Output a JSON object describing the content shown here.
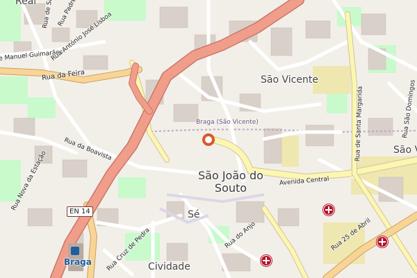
{
  "map": {
    "colors": {
      "background": "#f2efe9",
      "building": "#d9d0c9",
      "primary_road": "#f09e8a",
      "secondary_road": "#f9d497",
      "tertiary_road": "#fcf6b1",
      "minor_road": "#ffffff",
      "park": "#c8facc",
      "railway": "#b9a9c4",
      "marker": "#d65a2c",
      "hospital": "#b3152b"
    },
    "places": {
      "real": "Real",
      "sao_vicente": "São Vicente",
      "sao_joao_line1": "São João do",
      "sao_joao_line2": "Souto",
      "se": "Sé",
      "cividade": "Cividade",
      "sao_v_partial": "São V"
    },
    "streets": {
      "rua_da_feira": "Rua da Feira",
      "rua_da_boavista": "Rua da Boavista",
      "rua_nova_da_estacao": "Rua Nova da Estação",
      "avenida_central": "Avenida Central",
      "rua_de_santa_margarida": "Rua de Santa Margarida",
      "rua_sao_domingos": "Rua São Domingos",
      "rua_25_de_abril": "Rua 25 de Abril",
      "rua_do_anjo": "Rua do Anjo",
      "rua_cruz_de_pedra": "Rua Cruz de Pedra",
      "rua_manuel_guimaraes": "e Manuel Guimarães",
      "rua_antonio_jose_lisboa": "Rua António José Lisboa",
      "rua_padre": "Rua Padre",
      "rua_sa": "Rua de Sá"
    },
    "railway_label": "Braga (São Vicente)",
    "road_ref": "EN 14",
    "station": "Braga",
    "icons": {
      "marker": "location-marker-icon",
      "hospital": "hospital-icon",
      "station": "train-station-icon"
    }
  }
}
